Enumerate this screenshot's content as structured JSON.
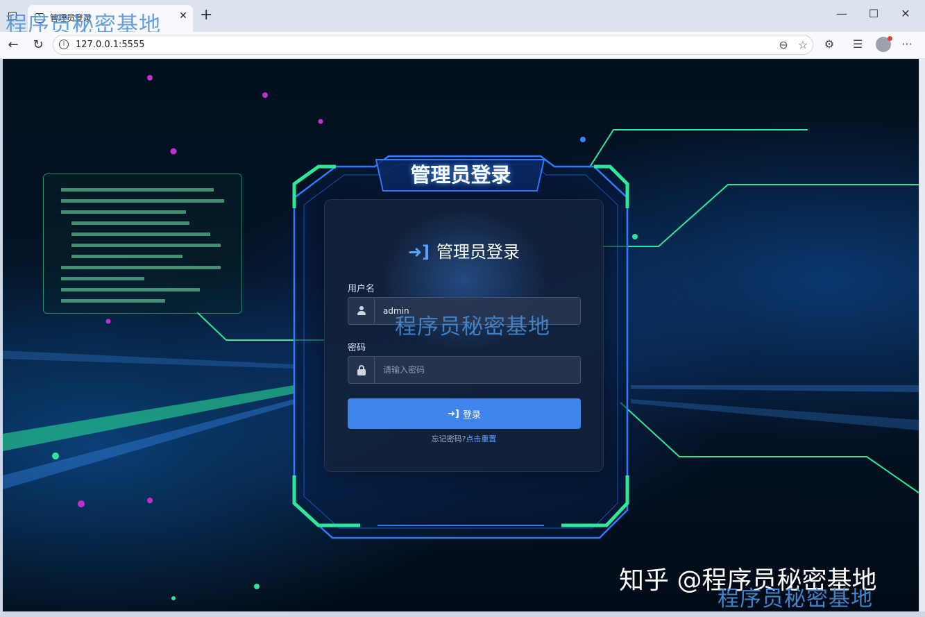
{
  "browser": {
    "tab_title": "管理员登录",
    "tab_close": "✕",
    "new_tab": "+",
    "minimize": "—",
    "maximize": "☐",
    "close": "✕",
    "url": "127.0.0.1:5555",
    "more": "···"
  },
  "page": {
    "frame_title": "管理员登录",
    "card_title": "管理员登录",
    "username_label": "用户名",
    "username_value": "admin",
    "password_label": "密码",
    "password_placeholder": "请输入密码",
    "submit_label": "登录",
    "forgot_text": "忘记密码?",
    "forgot_link": "点击重置"
  },
  "watermarks": {
    "site": "程序员秘密基地",
    "credit": "知乎 @程序员秘密基地"
  },
  "colors": {
    "accent": "#3f84ea",
    "neon_green": "#2ee89a",
    "neon_blue": "#2f7bff"
  }
}
